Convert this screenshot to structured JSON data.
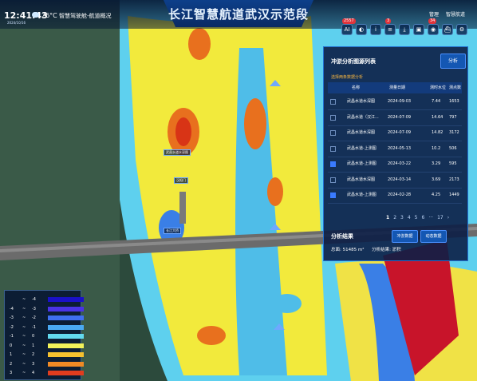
{
  "header": {
    "title": "长江智慧航道武汉示范段",
    "time": "12:41:43",
    "date": "2024/10/16",
    "temperature": "26°C",
    "subtitle": "智慧驾驶舱-航道概况",
    "top_right": {
      "manage": "管理",
      "brand": "智慧航道"
    }
  },
  "toolbar": {
    "items": [
      {
        "icon": "ai-icon",
        "label": "AI",
        "badge": "2557"
      },
      {
        "icon": "layer-icon",
        "label": "◐"
      },
      {
        "icon": "info-icon",
        "label": "i"
      },
      {
        "icon": "doc-icon",
        "label": "≡",
        "badge": "3"
      },
      {
        "icon": "download-icon",
        "label": "⤓"
      },
      {
        "icon": "image-icon",
        "label": "▣"
      },
      {
        "icon": "alert-icon",
        "label": "◉",
        "badge": "34"
      },
      {
        "icon": "ship-icon",
        "label": "⛴"
      },
      {
        "icon": "settings-icon",
        "label": "⚙"
      }
    ]
  },
  "panel": {
    "title": "冲淤分析图源列表",
    "analyze_button": "分析",
    "hint": "选择两条数据分析",
    "headers": {
      "name": "名称",
      "date": "测量日期",
      "level": "测时水位",
      "points": "测点数"
    },
    "rows": [
      {
        "name": "武昌水道水深图",
        "date": "2024-09-03",
        "level": "7.44",
        "points": "1653",
        "checked": false
      },
      {
        "name": "武昌水道（汉江...",
        "date": "2024-07-09",
        "level": "14.64",
        "points": "797",
        "checked": false
      },
      {
        "name": "武昌水道水深图",
        "date": "2024-07-09",
        "level": "14.82",
        "points": "3172",
        "checked": false
      },
      {
        "name": "武昌水道-上测图",
        "date": "2024-05-13",
        "level": "10.2",
        "points": "506",
        "checked": false
      },
      {
        "name": "武昌水道-上测图",
        "date": "2024-03-22",
        "level": "3.29",
        "points": "595",
        "checked": true
      },
      {
        "name": "武昌水道水深图",
        "date": "2024-03-14",
        "level": "3.69",
        "points": "2173",
        "checked": false
      },
      {
        "name": "武昌水道-上测图",
        "date": "2024-02-28",
        "level": "4.25",
        "points": "1449",
        "checked": true
      }
    ],
    "pager": {
      "current": "1",
      "pages": [
        "2",
        "3",
        "4",
        "5",
        "6"
      ],
      "last": "17",
      "prev": "‹",
      "next": "›",
      "ellipsis": "···"
    },
    "result_title": "分析结果",
    "area_label": "总面:",
    "area_value": "51485 m²",
    "conclusion": "分析结果: 淤积",
    "btn_scour": "冲淤数据",
    "btn_dynamic": "动态数据"
  },
  "legend": {
    "rows": [
      {
        "min": "",
        "max": "-4",
        "color": "#1a10c8"
      },
      {
        "min": "-4",
        "max": "-3",
        "color": "#4a33e6"
      },
      {
        "min": "-3",
        "max": "-2",
        "color": "#3f6ff0"
      },
      {
        "min": "-2",
        "max": "-1",
        "color": "#4aa9f2"
      },
      {
        "min": "-1",
        "max": "0",
        "color": "#62d9ee"
      },
      {
        "min": "0",
        "max": "1",
        "color": "#f2f25a"
      },
      {
        "min": "1",
        "max": "2",
        "color": "#f5c12f"
      },
      {
        "min": "2",
        "max": "3",
        "color": "#f08a25"
      },
      {
        "min": "3",
        "max": "4",
        "color": "#e23c1e"
      }
    ]
  },
  "map_labels": {
    "a": "武昌水道水深图",
    "b": "汉阳门",
    "c": "长江大桥"
  },
  "colors": {
    "accent": "#1f6fd1",
    "deposition": "#f2f25a",
    "erosion": "#3f6ff0"
  }
}
